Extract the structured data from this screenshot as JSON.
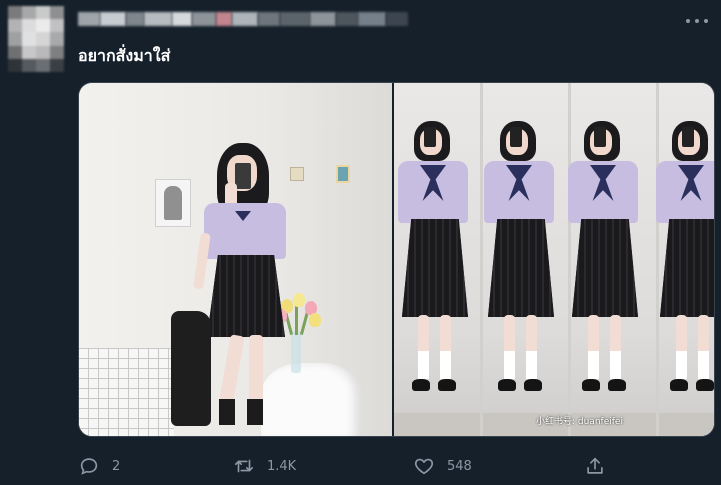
{
  "tweet": {
    "text": "อยากสั่งมาใส่",
    "photo_credit": "小红书号: duanfeifei"
  },
  "actions": {
    "reply_count": "2",
    "retweet_count": "1.4K",
    "like_count": "548"
  },
  "icons": {
    "reply": "reply-icon",
    "retweet": "retweet-icon",
    "like": "heart-icon",
    "share": "share-icon",
    "more": "more-options-icon"
  },
  "colors": {
    "background": "#15202b",
    "secondary_text": "#8b98a5",
    "primary_text": "#ffffff",
    "uniform_shirt": "#c6bde0",
    "uniform_tie": "#2b2f5c"
  }
}
